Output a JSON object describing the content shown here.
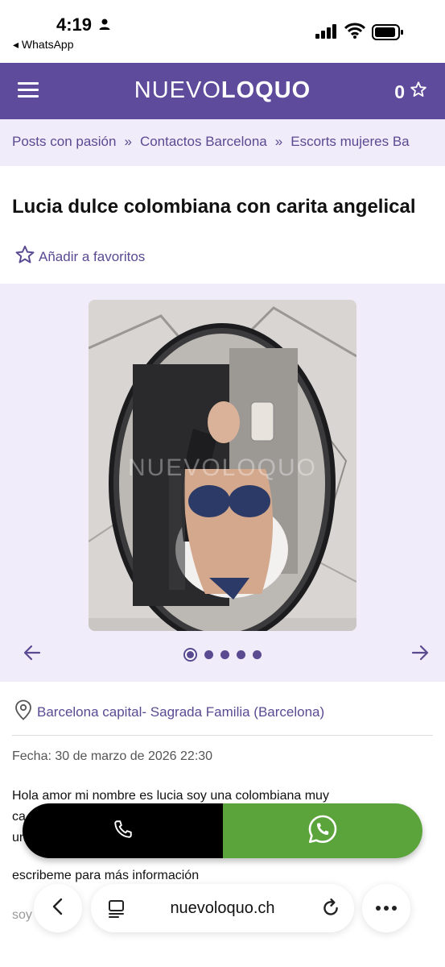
{
  "status_bar": {
    "time": "4:19",
    "back_app": "◂ WhatsApp"
  },
  "header": {
    "logo_part1": "NUEVO",
    "logo_part2": "LOQUO",
    "favorites_count": "0"
  },
  "breadcrumb": {
    "items": [
      "Posts con pasión",
      "Contactos Barcelona",
      "Escorts mujeres Ba"
    ],
    "separator": "»"
  },
  "listing": {
    "title": "Lucia dulce colombiana con carita angelical",
    "add_favorite_label": "Añadir a favoritos",
    "photo_watermark": "NUEVOLOQUO",
    "gallery_count": 5,
    "gallery_active_index": 0,
    "location": "Barcelona capital- Sagrada Familia (Barcelona)",
    "date": "Fecha: 30 de marzo de 2026 22:30",
    "description_line1": "Hola amor mi nombre es lucia soy una colombiana muy",
    "description_line2": "ca",
    "description_line3": "un",
    "description_more": "escribeme para más información",
    "description_faded": "soy"
  },
  "browser": {
    "url": "nuevoloquo.ch"
  },
  "colors": {
    "brand": "#5f4b9b",
    "breadcrumb_bg": "#f0ecf9",
    "whatsapp": "#5ba33b"
  }
}
